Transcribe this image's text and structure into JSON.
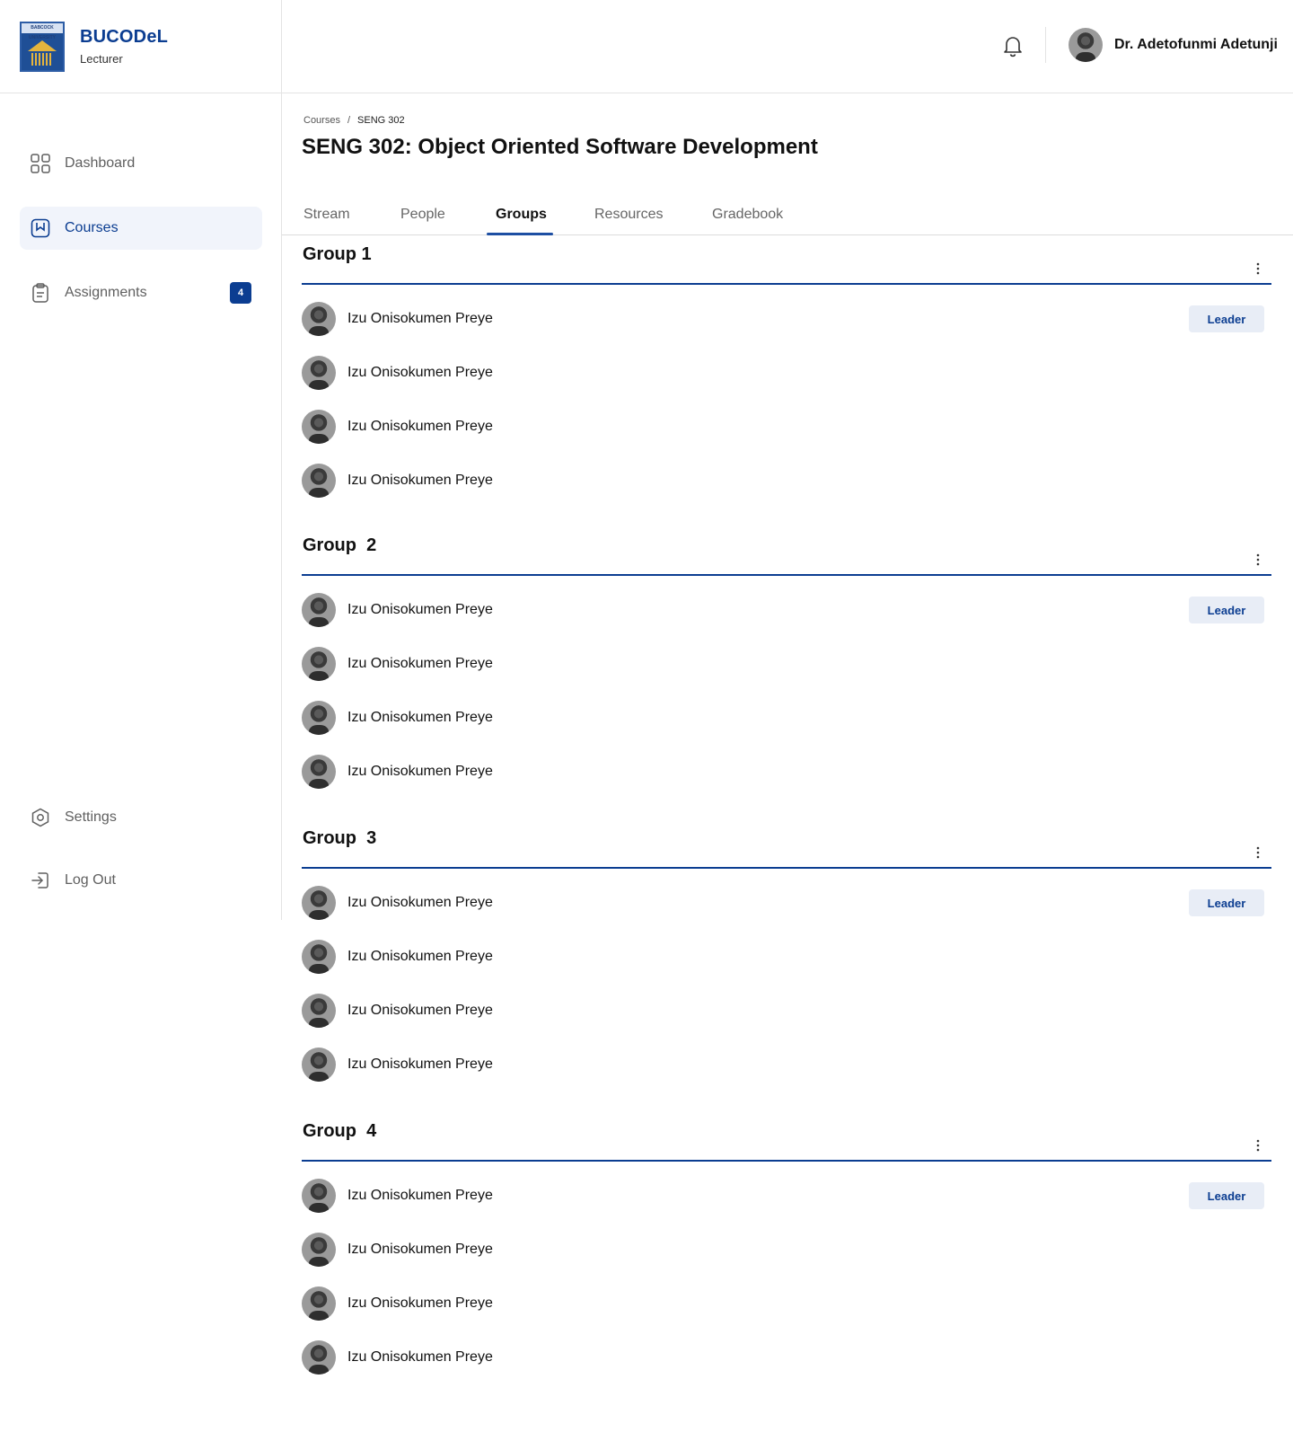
{
  "brand": {
    "name": "BUCODeL",
    "role": "Lecturer",
    "logo_text": "BABCOCK UNIVERSITY"
  },
  "nav": {
    "items": [
      {
        "label": "Dashboard",
        "icon": "grid-icon"
      },
      {
        "label": "Courses",
        "icon": "book-icon"
      },
      {
        "label": "Assignments",
        "icon": "clipboard-icon",
        "badge": "4"
      }
    ],
    "bottom": [
      {
        "label": "Settings",
        "icon": "gear-icon"
      },
      {
        "label": "Log Out",
        "icon": "logout-icon"
      }
    ]
  },
  "topbar": {
    "user_name": "Dr. Adetofunmi Adetunji"
  },
  "breadcrumb": {
    "root": "Courses",
    "separator": "/",
    "current": "SENG 302"
  },
  "page_title": "SENG 302: Object Oriented Software Development",
  "tabs": [
    "Stream",
    "People",
    "Groups",
    "Resources",
    "Gradebook"
  ],
  "active_tab": "Groups",
  "colors": {
    "accent": "#0b3d91",
    "active_bg": "#f1f4fb",
    "badge_bg": "#e8edf6"
  },
  "leader_label": "Leader",
  "groups": [
    {
      "title": "Group 1",
      "members": [
        "Izu Onisokumen Preye",
        "Izu Onisokumen Preye",
        "Izu Onisokumen Preye",
        "Izu Onisokumen Preye"
      ]
    },
    {
      "title": "Group  2",
      "members": [
        "Izu Onisokumen Preye",
        "Izu Onisokumen Preye",
        "Izu Onisokumen Preye",
        "Izu Onisokumen Preye"
      ]
    },
    {
      "title": "Group  3",
      "members": [
        "Izu Onisokumen Preye",
        "Izu Onisokumen Preye",
        "Izu Onisokumen Preye",
        "Izu Onisokumen Preye"
      ]
    },
    {
      "title": "Group  4",
      "members": [
        "Izu Onisokumen Preye",
        "Izu Onisokumen Preye",
        "Izu Onisokumen Preye",
        "Izu Onisokumen Preye"
      ]
    }
  ]
}
